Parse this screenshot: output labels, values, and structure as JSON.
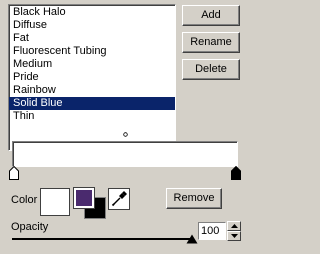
{
  "presets": {
    "items": [
      {
        "label": "Black Halo",
        "selected": false
      },
      {
        "label": "Diffuse",
        "selected": false
      },
      {
        "label": "Fat",
        "selected": false
      },
      {
        "label": "Fluorescent Tubing",
        "selected": false
      },
      {
        "label": "Medium",
        "selected": false
      },
      {
        "label": "Pride",
        "selected": false
      },
      {
        "label": "Rainbow",
        "selected": false
      },
      {
        "label": "Solid Blue",
        "selected": true
      },
      {
        "label": "Thin",
        "selected": false
      }
    ]
  },
  "buttons": {
    "add": "Add",
    "rename": "Rename",
    "delete": "Delete",
    "remove": "Remove"
  },
  "color": {
    "label": "Color",
    "swatch_color": "#ffffff",
    "foreground": "#4a2a6e",
    "background": "#000000",
    "selection_color": "#0a246a"
  },
  "opacity": {
    "label": "Opacity",
    "value": "100",
    "fraction": 1.0
  },
  "icons": {
    "eyedropper": "eyedropper-icon",
    "spin_up": "spin-up-icon",
    "spin_down": "spin-down-icon"
  }
}
